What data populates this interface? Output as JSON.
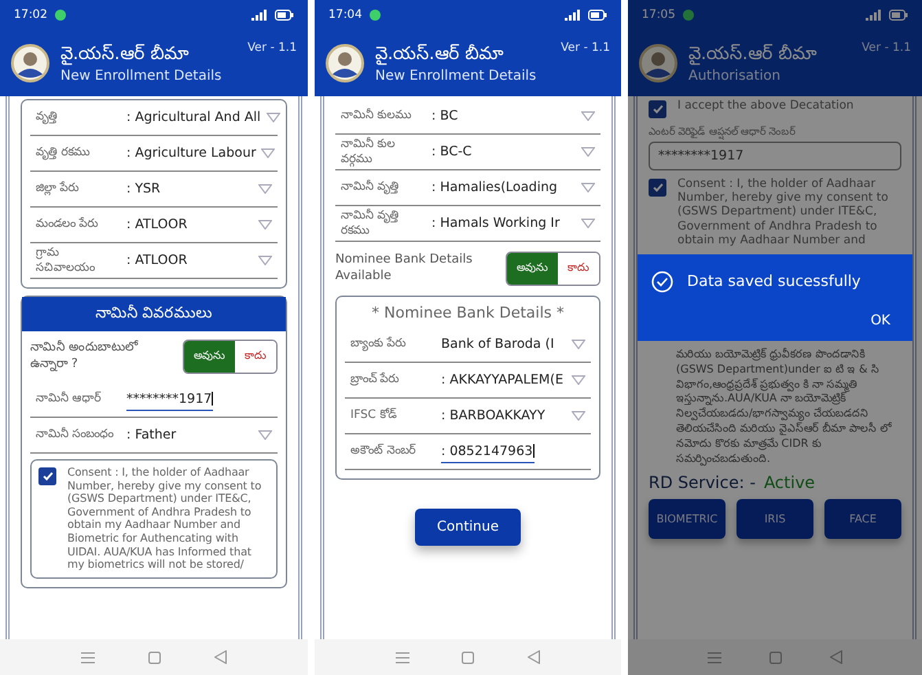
{
  "screens": [
    {
      "status_bar": {
        "time": "17:02"
      },
      "header": {
        "title": "వై.యస్.ఆర్ బీమా",
        "subtitle": "New Enrollment Details",
        "version": "Ver - 1.1"
      },
      "blocks": [
        {
          "kind": "card",
          "blocks": [
            {
              "kind": "fields",
              "rows": [
                {
                  "label": "వృత్తి",
                  "value": ": Agricultural And All",
                  "kind": "dropdown"
                },
                {
                  "label": "వృత్తి రకము",
                  "value": ": Agriculture Labour",
                  "kind": "dropdown"
                },
                {
                  "label": "జిల్లా పేరు",
                  "value": ": YSR",
                  "kind": "dropdown"
                },
                {
                  "label": "మండలం పేరు",
                  "value": ": ATLOOR",
                  "kind": "dropdown"
                },
                {
                  "label": "గ్రామ సచివాలయం",
                  "value": ": ATLOOR",
                  "kind": "dropdown"
                }
              ]
            }
          ]
        },
        {
          "kind": "card",
          "heading": "నామినీ వివరములు",
          "blocks": [
            {
              "kind": "toggle",
              "label": "నామినీ అందుబాటులో ఉన్నారా ?",
              "options": [
                {
                  "label": "అవును",
                  "selected": true
                },
                {
                  "label": "కాదు",
                  "selected": false
                }
              ]
            },
            {
              "kind": "fields",
              "rows": [
                {
                  "label": "నామినీ ఆధార్",
                  "value": "********1917",
                  "kind": "input"
                },
                {
                  "label": "నామినీ సంబంధం",
                  "value": ": Father",
                  "kind": "dropdown"
                }
              ]
            },
            {
              "kind": "checkbox",
              "checked": true,
              "boxed": true,
              "texts": [
                "Consent : I, the holder of Aadhaar Number, hereby give my consent to (GSWS Department) under ITE&C, Government of Andhra Pradesh to obtain my Aadhaar Number and Biometric for Authencating with UIDAI. AUA/KUA has Informed that my biometrics will not be stored/"
              ]
            }
          ]
        }
      ]
    },
    {
      "status_bar": {
        "time": "17:04"
      },
      "header": {
        "title": "వై.యస్.ఆర్ బీమా",
        "subtitle": "New Enrollment Details",
        "version": "Ver - 1.1"
      },
      "blocks": [
        {
          "kind": "fields",
          "rows": [
            {
              "label": "నామినీ కులము",
              "value": ": BC",
              "kind": "dropdown"
            },
            {
              "label": "నామినీ కుల వర్గము",
              "value": ": BC-C",
              "kind": "dropdown"
            },
            {
              "label": "నామినీ వృత్తి",
              "value": ": Hamalies(Loading",
              "kind": "dropdown"
            },
            {
              "label": "నామినీ వృత్తి రకము",
              "value": ": Hamals Working Ir",
              "kind": "dropdown"
            }
          ]
        },
        {
          "kind": "toggle",
          "label": "Nominee Bank Details Available",
          "options": [
            {
              "label": "అవును",
              "selected": true
            },
            {
              "label": "కాదు",
              "selected": false
            }
          ]
        },
        {
          "kind": "card",
          "title": "* Nominee Bank Details *",
          "blocks": [
            {
              "kind": "fields",
              "rows": [
                {
                  "label": "బ్యాంకు పేరు",
                  "value": "Bank of Baroda (I",
                  "kind": "dropdown"
                },
                {
                  "label": "బ్రాంచ్ పేరు",
                  "value": ": AKKAYYAPALEM(E",
                  "kind": "dropdown"
                },
                {
                  "label": "IFSC కోడ్",
                  "value": ": BARBOAKKAYY",
                  "kind": "dropdown"
                },
                {
                  "label": "అకౌంట్ నెంబర్",
                  "value": ": 0852147963",
                  "kind": "input"
                }
              ]
            }
          ]
        },
        {
          "kind": "button",
          "label": "Continue"
        }
      ]
    },
    {
      "status_bar": {
        "time": "17:05"
      },
      "header": {
        "title": "వై.యస్.ఆర్ బీమా",
        "subtitle": "Authorisation",
        "version": "Ver - 1.1"
      },
      "blocks": [
        {
          "kind": "checkbox",
          "checked": true,
          "boxed": false,
          "texts": [
            "I accept the above Decatation"
          ]
        },
        {
          "kind": "textbox",
          "label": "ఎంటర్ వెరిఫైడ్ ఆప్షనల్ ఆధార్ నెంబర్",
          "value": "********1917"
        },
        {
          "kind": "checkbox",
          "checked": true,
          "boxed": false,
          "texts": [
            "Consent : I, the holder of Aadhaar Number, hereby give my consent to (GSWS Department) under ITE&C, Government of Andhra Pradesh to obtain my Aadhaar Number and"
          ]
        },
        {
          "kind": "dialog",
          "message": "Data saved sucessfully",
          "button": "OK"
        },
        {
          "kind": "paragraph",
          "text": "మరియు బయోమెట్రిక్ ధ్రువీకరణ పొందడానికి (GSWS Department)under ఐ టి ఇ & సి విభాగం,ఆంధ్రప్రదేశ్ ప్రభుత్వం కి నా సమ్మతి ఇస్తున్నాను.AUA/KUA నా బయోమెట్రిక్ నిల్వచేయబడదు/భాగస్వామ్యం చేయబడదని తెలియచేసింది మరియు వైఎస్ఆర్ బీమా పాలసీ లో నమోదు కొరకు మాత్రమే CIDR కు సమర్పించబడుతుంది."
        },
        {
          "kind": "status",
          "label": "RD Service: -",
          "value": "Active"
        },
        {
          "kind": "buttons",
          "items": [
            "BIOMETRIC",
            "IRIS",
            "FACE"
          ]
        }
      ]
    }
  ]
}
